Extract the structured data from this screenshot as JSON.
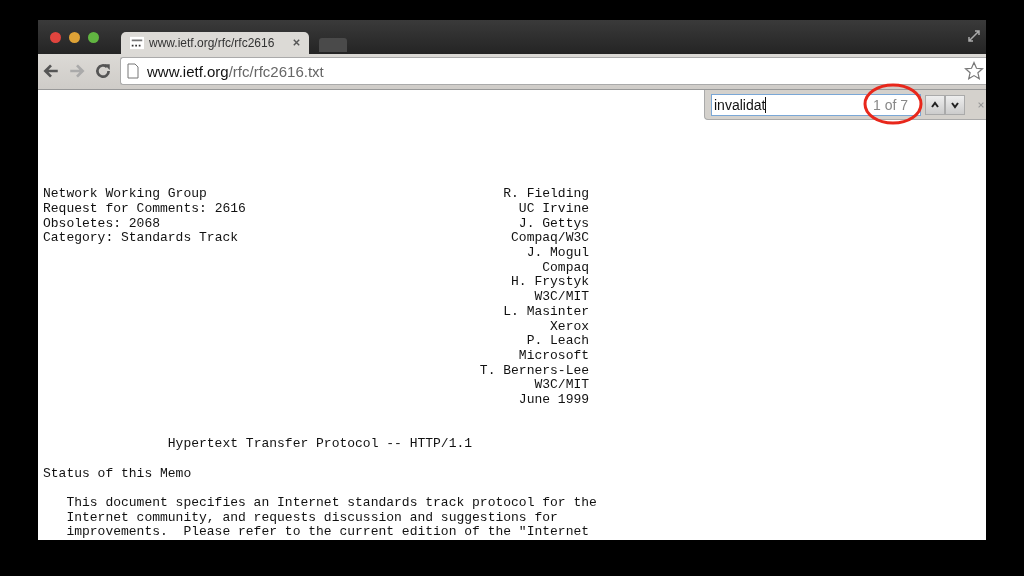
{
  "tabs": [
    {
      "title": "www.ietf.org/rfc/rfc2616",
      "selected": true
    },
    {
      "selected": false
    }
  ],
  "address": {
    "host": "www.ietf.org",
    "path": "/rfc/rfc2616.txt"
  },
  "find_bar": {
    "value": "invalidat",
    "count": "1 of 7"
  },
  "document": {
    "header": [
      {
        "left": "Network Working Group",
        "right": "R. Fielding"
      },
      {
        "left": "Request for Comments: 2616",
        "right": "UC Irvine"
      },
      {
        "left": "Obsoletes: 2068",
        "right": "J. Gettys"
      },
      {
        "left": "Category: Standards Track",
        "right": "Compaq/W3C"
      },
      {
        "right": "J. Mogul"
      },
      {
        "right": "Compaq"
      },
      {
        "right": "H. Frystyk"
      },
      {
        "right": "W3C/MIT"
      },
      {
        "right": "L. Masinter"
      },
      {
        "right": "Xerox"
      },
      {
        "right": "P. Leach"
      },
      {
        "right": "Microsoft"
      },
      {
        "right": "T. Berners-Lee"
      },
      {
        "right": "W3C/MIT"
      },
      {
        "right": "June 1999"
      }
    ],
    "title": "Hypertext Transfer Protocol -- HTTP/1.1",
    "section": "Status of this Memo",
    "paragraph": [
      "This document specifies an Internet standards track protocol for the",
      "Internet community, and requests discussion and suggestions for",
      "improvements.  Please refer to the current edition of the \"Internet"
    ]
  }
}
